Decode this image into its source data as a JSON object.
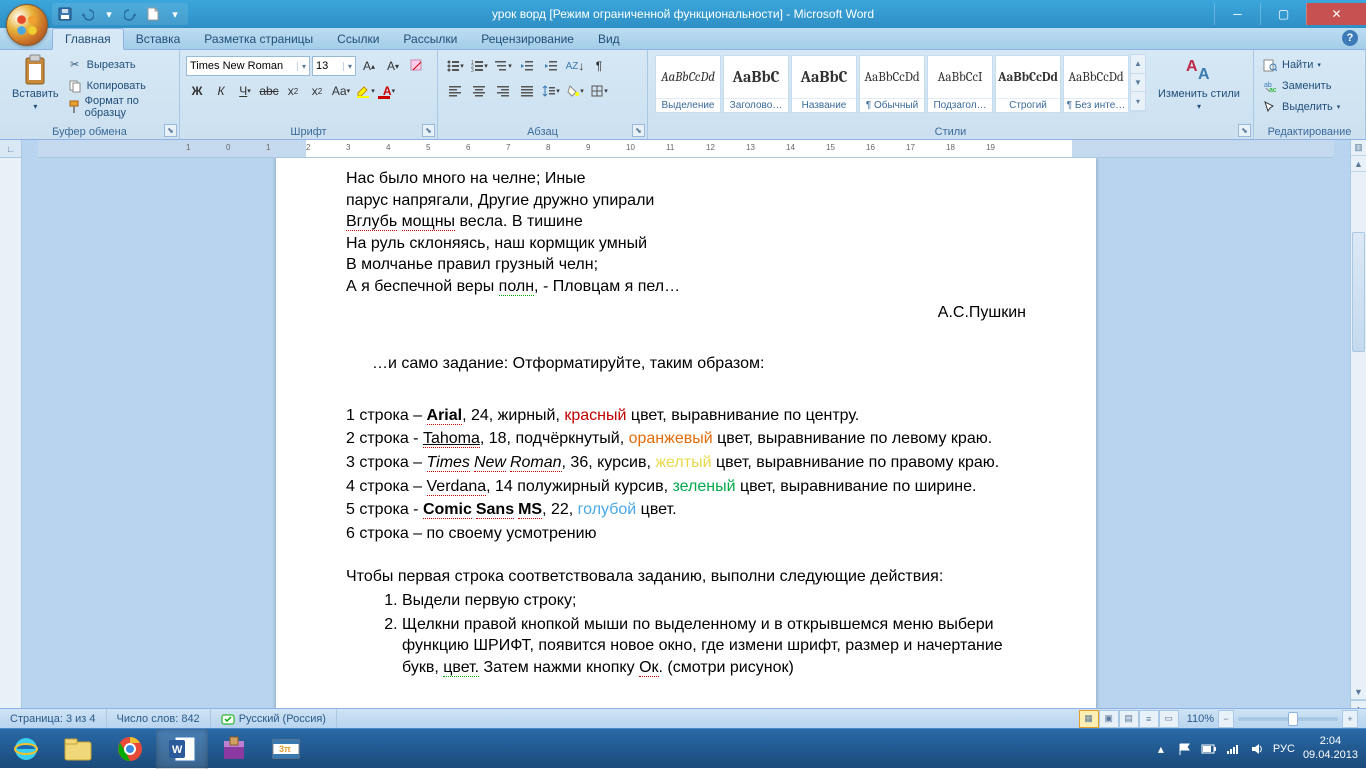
{
  "title": "урок ворд [Режим ограниченной функциональности] - Microsoft Word",
  "tabs": [
    "Главная",
    "Вставка",
    "Разметка страницы",
    "Ссылки",
    "Рассылки",
    "Рецензирование",
    "Вид"
  ],
  "group_labels": {
    "clipboard": "Буфер обмена",
    "font": "Шрифт",
    "paragraph": "Абзац",
    "styles": "Стили",
    "editing": "Редактирование"
  },
  "clipboard": {
    "paste": "Вставить",
    "cut": "Вырезать",
    "copy": "Копировать",
    "format_painter": "Формат по образцу"
  },
  "font": {
    "name": "Times New Roman",
    "size": "13"
  },
  "styles": [
    {
      "preview": "AaBbCcDd",
      "label": "Выделение",
      "italic": true
    },
    {
      "preview": "AaBbC",
      "label": "Заголово…",
      "bold": true,
      "size": 16
    },
    {
      "preview": "AaBbC",
      "label": "Название",
      "bold": true,
      "size": 16
    },
    {
      "preview": "AaBbCcDd",
      "label": "¶ Обычный"
    },
    {
      "preview": "AaBbCcI",
      "label": "Подзагол…"
    },
    {
      "preview": "AaBbCcDd",
      "label": "Строгий",
      "bold": true
    },
    {
      "preview": "AaBbCcDd",
      "label": "¶ Без инте…"
    }
  ],
  "change_styles": "Изменить стили",
  "editing": {
    "find": "Найти",
    "replace": "Заменить",
    "select": "Выделить"
  },
  "doc": {
    "poem": [
      "Нас было много на челне; Иные",
      "парус напрягали, Другие дружно упирали",
      "Вглубь мощны весла. В тишине",
      "На руль склоняясь, наш кормщик умный",
      "В молчанье правил грузный челн;",
      "А я беспечной веры полн,  - Пловцам я пел…"
    ],
    "author": "А.С.Пушкин",
    "task_intro": "…и само задание: Отформатируйте, таким образом:",
    "lines": [
      {
        "n": "1 строка – ",
        "font": "Arial",
        "fstyle": "font-family:Arial;font-weight:bold",
        "rest": ", 24, жирный, ",
        "color_word": "красный",
        "color": "#c00000",
        "tail": " цвет,  выравнивание по центру."
      },
      {
        "n": "2 строка - ",
        "font": "Tahoma",
        "fstyle": "font-family:Tahoma;text-decoration:underline",
        "rest": ", 18, подчёркнутый, ",
        "color_word": "оранжевый",
        "color": "#e36c0a",
        "tail": " цвет, выравнивание по левому краю."
      },
      {
        "n": "3 строка – ",
        "font": "Times New Roman",
        "fstyle": "font-family:'Times New Roman';font-style:italic",
        "rest": ", 36, курсив, ",
        "color_word": "желтый",
        "color": "#e8d84a",
        "tail": " цвет,  выравнивание по правому краю."
      },
      {
        "n": "4 строка – ",
        "font": "Verdana",
        "fstyle": "font-family:Verdana",
        "rest": ", 14 полужирный курсив, ",
        "color_word": "зеленый",
        "color": "#00a84a",
        "tail": " цвет,  выравнивание по ширине."
      },
      {
        "n": "5 строка - ",
        "font": "Comic Sans MS",
        "fstyle": "font-family:'Comic Sans MS';font-weight:bold",
        "rest": ", 22,  ",
        "color_word": "голубой",
        "color": "#4aa8e8",
        "tail": " цвет."
      },
      {
        "n": "6 строка – по своему усмотрению",
        "font": "",
        "fstyle": "",
        "rest": "",
        "color_word": "",
        "color": "",
        "tail": ""
      }
    ],
    "instr_head": "Чтобы первая строка соответствовала заданию, выполни следующие действия:",
    "ol": [
      "Выдели первую строку;",
      "Щелкни правой кнопкой мыши по выделенному и в открывшемся меню выбери функцию ШРИФТ, появится новое окно, где измени шрифт, размер и начертание букв, цвет. Затем нажми кнопку Ок. (смотри рисунок)"
    ]
  },
  "status": {
    "page": "Страница: 3 из 4",
    "words": "Число слов: 842",
    "lang": "Русский (Россия)",
    "zoom": "110%"
  },
  "tray": {
    "lang": "РУС",
    "time": "2:04",
    "date": "09.04.2013"
  }
}
